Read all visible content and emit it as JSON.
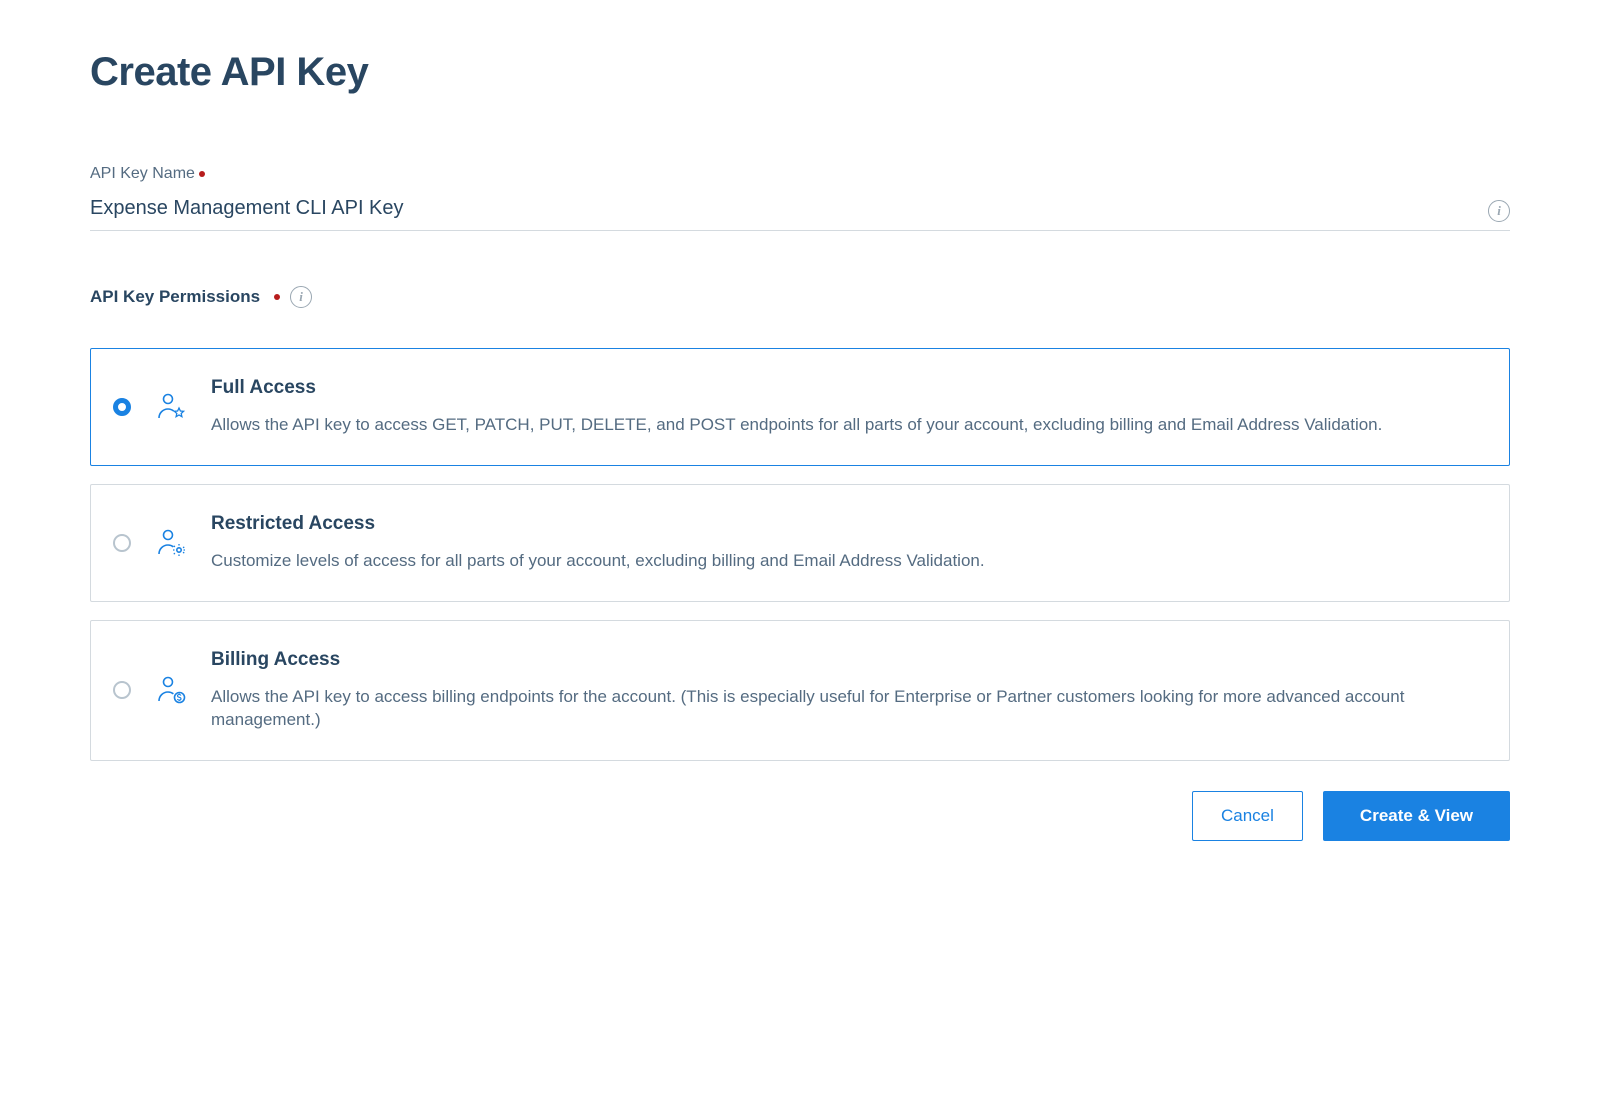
{
  "page": {
    "title": "Create API Key"
  },
  "form": {
    "name_label": "API Key Name",
    "name_value": "Expense Management CLI API Key",
    "permissions_label": "API Key Permissions"
  },
  "options": [
    {
      "id": "full",
      "title": "Full Access",
      "description": "Allows the API key to access GET, PATCH, PUT, DELETE, and POST endpoints for all parts of your account, excluding billing and Email Address Validation.",
      "selected": true,
      "icon": "user-star"
    },
    {
      "id": "restricted",
      "title": "Restricted Access",
      "description": "Customize levels of access for all parts of your account, excluding billing and Email Address Validation.",
      "selected": false,
      "icon": "user-gear"
    },
    {
      "id": "billing",
      "title": "Billing Access",
      "description": "Allows the API key to access billing endpoints for the account. (This is especially useful for Enterprise or Partner customers looking for more advanced account management.)",
      "selected": false,
      "icon": "user-dollar"
    }
  ],
  "buttons": {
    "cancel": "Cancel",
    "submit": "Create & View"
  }
}
